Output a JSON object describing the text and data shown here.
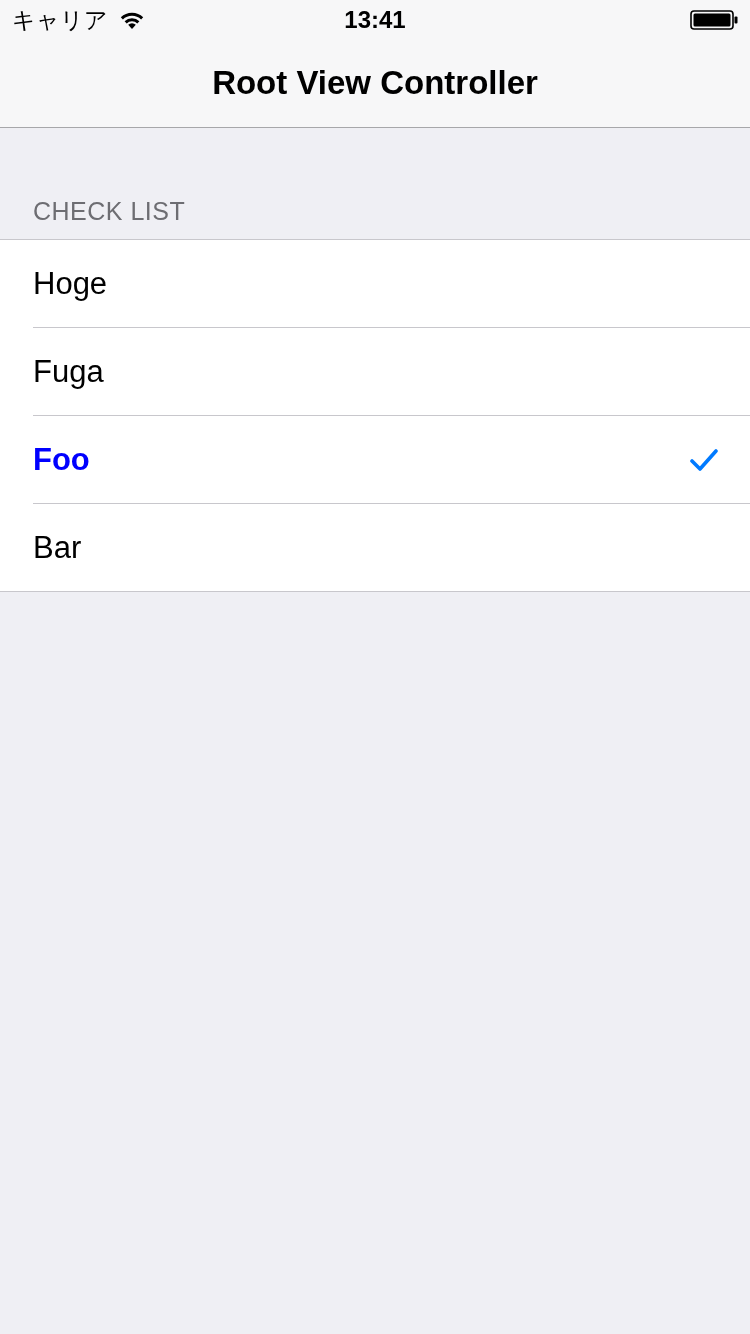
{
  "status_bar": {
    "carrier": "キャリア",
    "time": "13:41"
  },
  "nav_bar": {
    "title": "Root View Controller"
  },
  "section": {
    "header": "CHECK LIST",
    "items": [
      {
        "label": "Hoge",
        "selected": false
      },
      {
        "label": "Fuga",
        "selected": false
      },
      {
        "label": "Foo",
        "selected": true
      },
      {
        "label": "Bar",
        "selected": false
      }
    ]
  }
}
